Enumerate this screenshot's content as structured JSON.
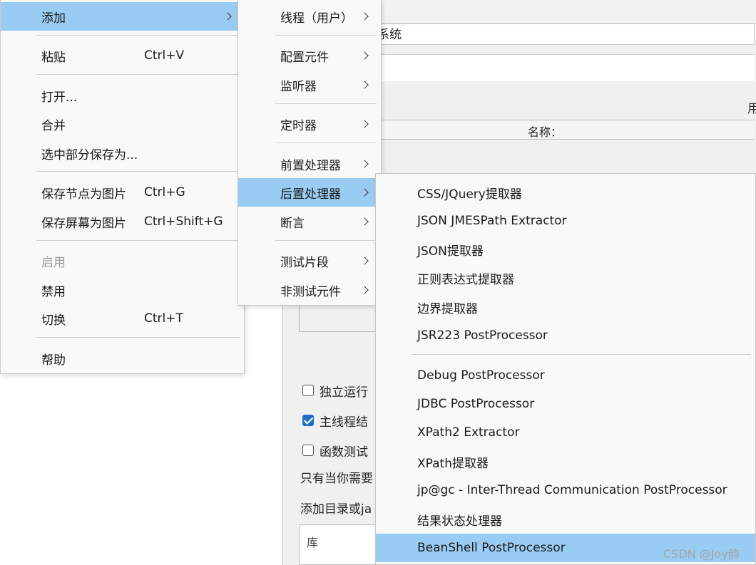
{
  "background": {
    "name_field_value": "系统",
    "right_label": "用",
    "column_header": "名称：",
    "checkboxes": [
      {
        "label": "独立运行",
        "checked": false
      },
      {
        "label": "主线程结",
        "checked": true
      },
      {
        "label": "函数测试",
        "checked": false
      }
    ],
    "hint_text": "只有当你需要",
    "classpath_label": "添加目录或ja",
    "library_header": "库"
  },
  "main_menu": {
    "items": [
      {
        "label": "添加",
        "shortcut": "",
        "submenu": true,
        "selected": true,
        "disabled": false
      },
      {
        "label": "粘贴",
        "shortcut": "Ctrl+V",
        "submenu": false,
        "selected": false,
        "disabled": false
      },
      {
        "label": "打开...",
        "shortcut": "",
        "submenu": false,
        "selected": false,
        "disabled": false
      },
      {
        "label": "合并",
        "shortcut": "",
        "submenu": false,
        "selected": false,
        "disabled": false
      },
      {
        "label": "选中部分保存为...",
        "shortcut": "",
        "submenu": false,
        "selected": false,
        "disabled": false
      },
      {
        "label": "保存节点为图片",
        "shortcut": "Ctrl+G",
        "submenu": false,
        "selected": false,
        "disabled": false
      },
      {
        "label": "保存屏幕为图片",
        "shortcut": "Ctrl+Shift+G",
        "submenu": false,
        "selected": false,
        "disabled": false
      },
      {
        "label": "启用",
        "shortcut": "",
        "submenu": false,
        "selected": false,
        "disabled": true
      },
      {
        "label": "禁用",
        "shortcut": "",
        "submenu": false,
        "selected": false,
        "disabled": false
      },
      {
        "label": "切换",
        "shortcut": "Ctrl+T",
        "submenu": false,
        "selected": false,
        "disabled": false
      },
      {
        "label": "帮助",
        "shortcut": "",
        "submenu": false,
        "selected": false,
        "disabled": false
      }
    ]
  },
  "add_menu": {
    "items": [
      {
        "label": "线程（用户）",
        "submenu": true,
        "selected": false
      },
      {
        "label": "配置元件",
        "submenu": true,
        "selected": false
      },
      {
        "label": "监听器",
        "submenu": true,
        "selected": false
      },
      {
        "label": "定时器",
        "submenu": true,
        "selected": false
      },
      {
        "label": "前置处理器",
        "submenu": true,
        "selected": false
      },
      {
        "label": "后置处理器",
        "submenu": true,
        "selected": true
      },
      {
        "label": "断言",
        "submenu": true,
        "selected": false
      },
      {
        "label": "测试片段",
        "submenu": true,
        "selected": false
      },
      {
        "label": "非测试元件",
        "submenu": true,
        "selected": false
      }
    ]
  },
  "post_processor_menu": {
    "items": [
      {
        "label": "CSS/JQuery提取器",
        "selected": false
      },
      {
        "label": "JSON JMESPath Extractor",
        "selected": false
      },
      {
        "label": "JSON提取器",
        "selected": false
      },
      {
        "label": "正则表达式提取器",
        "selected": false
      },
      {
        "label": "边界提取器",
        "selected": false
      },
      {
        "label": "JSR223 PostProcessor",
        "selected": false
      },
      {
        "label": "Debug PostProcessor",
        "selected": false
      },
      {
        "label": "JDBC PostProcessor",
        "selected": false
      },
      {
        "label": "XPath2 Extractor",
        "selected": false
      },
      {
        "label": "XPath提取器",
        "selected": false
      },
      {
        "label": "jp@gc - Inter-Thread Communication PostProcessor",
        "selected": false
      },
      {
        "label": "结果状态处理器",
        "selected": false
      },
      {
        "label": "BeanShell PostProcessor",
        "selected": true
      }
    ]
  },
  "watermark": "CSDN @Joy韵",
  "colors": {
    "selection": "#99ccf2",
    "checkbox_checked": "#1f6fc4",
    "disabled_text": "#9a9a9a"
  }
}
